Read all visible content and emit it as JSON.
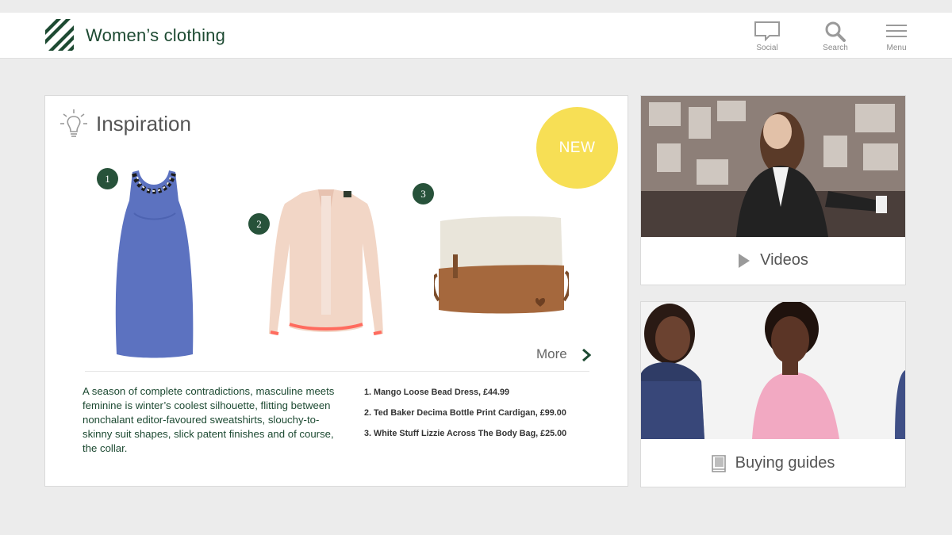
{
  "header": {
    "title": "Women’s clothing",
    "social_label": "Social",
    "search_label": "Search",
    "menu_label": "Menu",
    "brand_color": "#1d4a32"
  },
  "inspiration": {
    "title": "Inspiration",
    "badge": "NEW",
    "badge_color": "#f7df55",
    "products": [
      {
        "number": "1",
        "icon": "blue-dress-image"
      },
      {
        "number": "2",
        "icon": "cardigan-image"
      },
      {
        "number": "3",
        "icon": "bag-image"
      }
    ],
    "more_label": "More",
    "description": "A season of complete contradictions,  masculine meets feminine is winter’s coolest silhouette, flitting between nonchalant editor-favoured sweatshirts, slouchy-to-skinny suit shapes, slick patent finishes and of course, the collar.",
    "list": [
      "1.  Mango Loose Bead Dress, £44.99",
      "2. Ted Baker Decima Bottle Print Cardigan, £99.00",
      "3. White Stuff Lizzie Across The Body Bag, £25.00"
    ]
  },
  "videos": {
    "label": "Videos"
  },
  "guides": {
    "label": "Buying guides"
  }
}
